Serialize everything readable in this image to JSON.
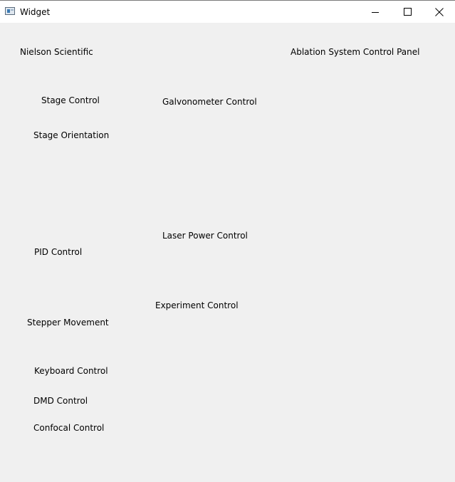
{
  "window": {
    "title": "Widget",
    "controls": {
      "minimize_icon": "minimize-icon",
      "maximize_icon": "maximize-icon",
      "close_icon": "close-icon"
    }
  },
  "header": {
    "company": "Nielson Scientific",
    "panel_title": "Ablation System Control Panel"
  },
  "sections": {
    "stage_control": "Stage Control",
    "galvanometer_control": "Galvonometer Control",
    "stage_orientation": "Stage Orientation",
    "laser_power_control": "Laser Power Control",
    "pid_control": "PID Control",
    "experiment_control": "Experiment Control",
    "stepper_movement": "Stepper Movement",
    "keyboard_control": "Keyboard Control",
    "dmd_control": "DMD Control",
    "confocal_control": "Confocal Control"
  }
}
